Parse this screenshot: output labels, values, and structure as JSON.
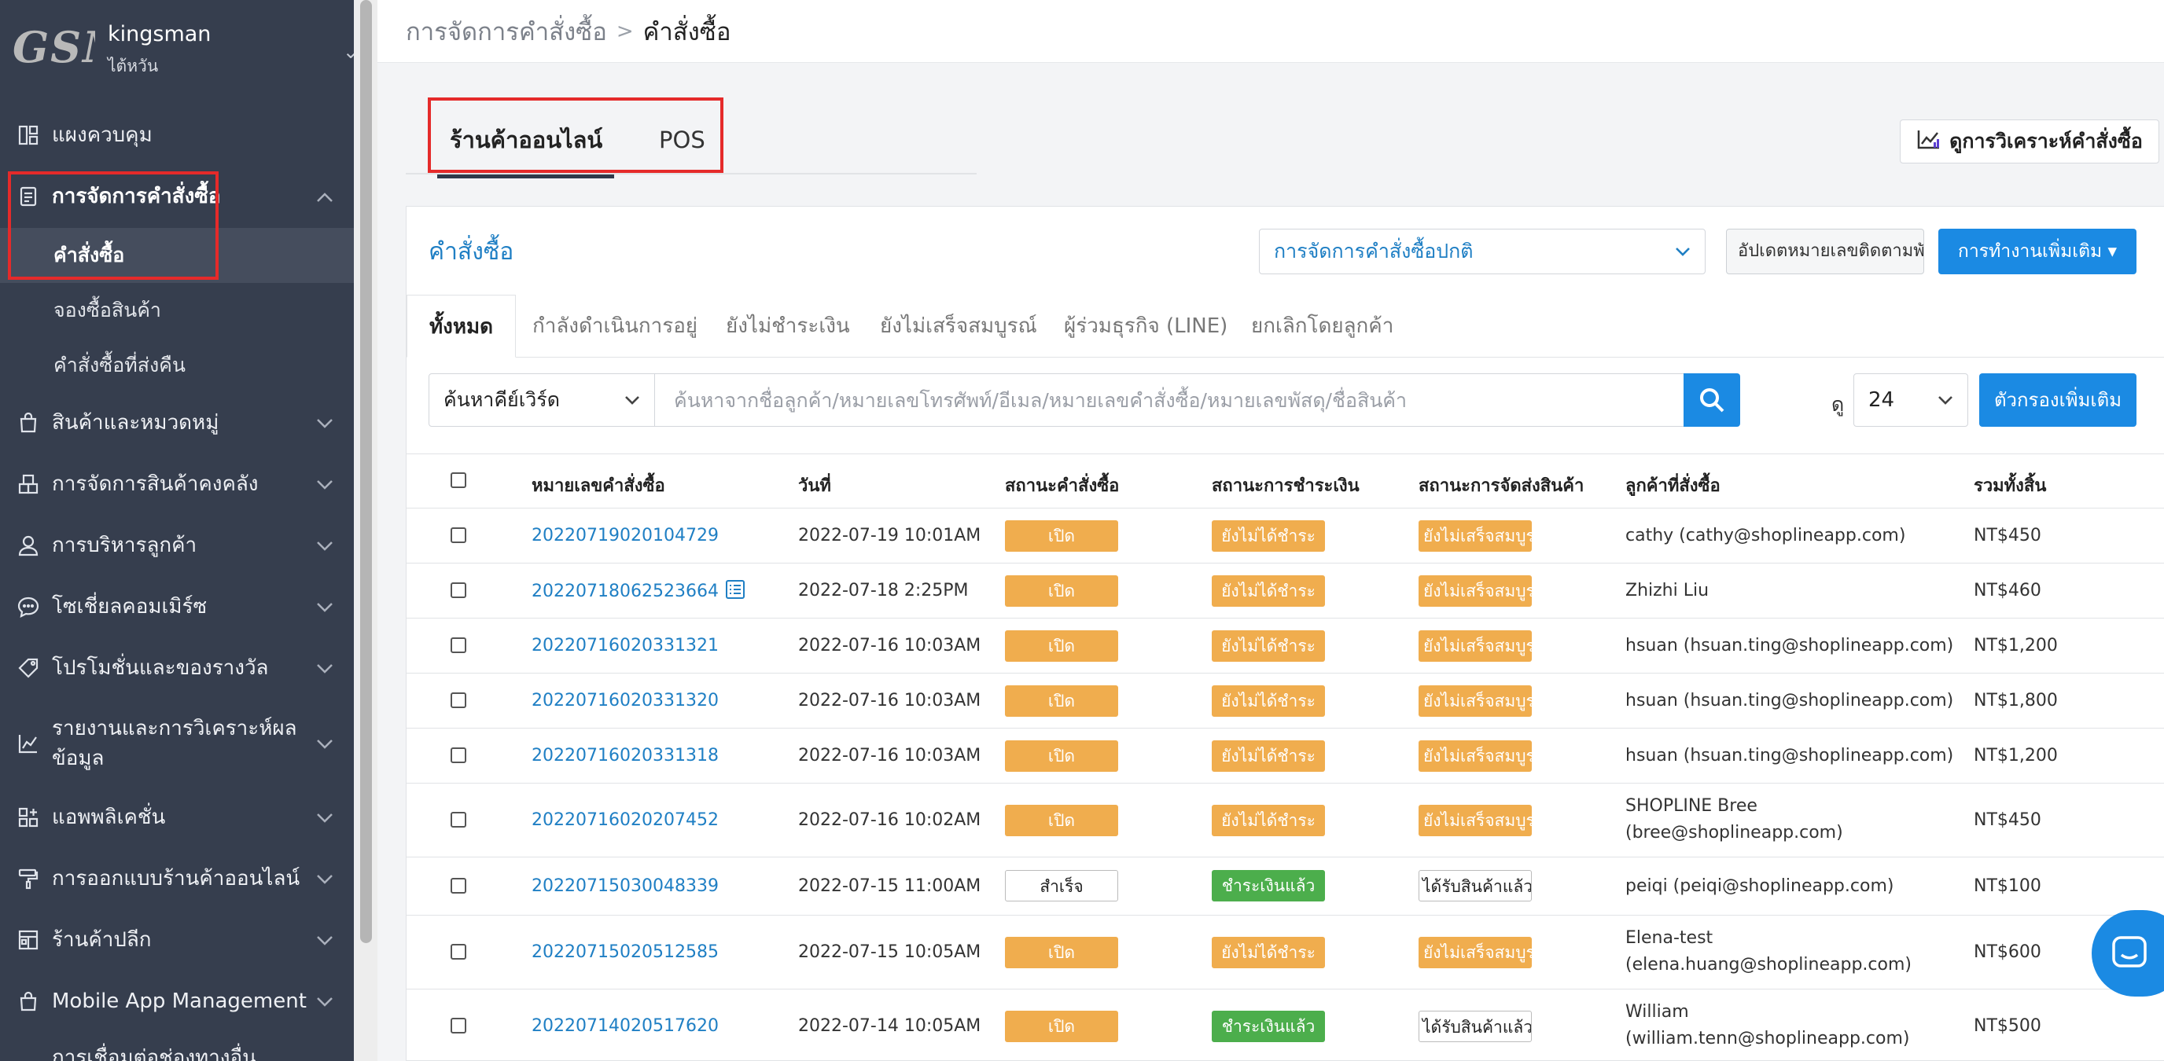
{
  "store": {
    "logo_text": "GSM",
    "name": "kingsman",
    "region": "ไต้หวัน"
  },
  "sidebar": {
    "items": [
      {
        "label": "แผงควบคุม",
        "icon": "dashboard-icon"
      },
      {
        "label": "การจัดการคำสั่งซื้อ",
        "icon": "order-list-icon",
        "expanded": true
      },
      {
        "label": "สินค้าและหมวดหมู่",
        "icon": "shopping-bag-icon"
      },
      {
        "label": "การจัดการสินค้าคงคลัง",
        "icon": "warehouse-icon"
      },
      {
        "label": "การบริหารลูกค้า",
        "icon": "user-icon"
      },
      {
        "label": "โซเชี่ยลคอมเมิร์ซ",
        "icon": "chat-icon"
      },
      {
        "label": "โปรโมชั่นและของรางวัล",
        "icon": "tag-icon"
      },
      {
        "label": "รายงานและการวิเคราะห์ผลข้อมูล",
        "icon": "chart-icon"
      },
      {
        "label": "แอพพลิเคชั่น",
        "icon": "apps-icon"
      },
      {
        "label": "การออกแบบร้านค้าออนไลน์",
        "icon": "brush-icon"
      },
      {
        "label": "ร้านค้าปลีก",
        "icon": "store-icon"
      },
      {
        "label": "Mobile App Management",
        "icon": "mobile-icon"
      },
      {
        "label": "การเชื่อมต่อช่องทางอื่น",
        "icon": "link-icon"
      }
    ],
    "order_submenu": [
      {
        "label": "คำสั่งซื้อ",
        "current": true
      },
      {
        "label": "จองซื้อสินค้า"
      },
      {
        "label": "คำสั่งซื้อที่ส่งคืน"
      }
    ]
  },
  "breadcrumb": {
    "parent": "การจัดการคำสั่งซื้อ",
    "separator": ">",
    "current": "คำสั่งซื้อ"
  },
  "channel_tabs": [
    {
      "label": "ร้านค้าออนไลน์",
      "active": true
    },
    {
      "label": "POS"
    }
  ],
  "analytics_button": "ดูการวิเคราะห์คำสั่งซื้อ",
  "panel": {
    "title": "คำสั่งซื้อ",
    "flow_select": "การจัดการคำสั่งซื้อปกติ",
    "tracking_button": "อัปเดตหมายเลขติดตามพัสดุ",
    "more_actions_button": "การทำงานเพิ่มเติม ▾"
  },
  "status_tabs": [
    {
      "label": "ทั้งหมด",
      "active": true
    },
    {
      "label": "กำลังดำเนินการอยู่"
    },
    {
      "label": "ยังไม่ชำระเงิน"
    },
    {
      "label": "ยังไม่เสร็จสมบูรณ์"
    },
    {
      "label": "ผู้ร่วมธุรกิจ (LINE)"
    },
    {
      "label": "ยกเลิกโดยลูกค้า"
    }
  ],
  "search": {
    "keyword_select": "ค้นหาคีย์เวิร์ด",
    "placeholder": "ค้นหาจากชื่อลูกค้า/หมายเลขโทรศัพท์/อีเมล/หมายเลขคำสั่งซื้อ/หมายเลขพัสดุ/ชื่อสินค้า",
    "view_label": "ดู",
    "per_page": "24",
    "filter_button": "ตัวกรองเพิ่มเติม"
  },
  "table": {
    "headers": [
      "หมายเลขคำสั่งซื้อ",
      "วันที่",
      "สถานะคำสั่งซื้อ",
      "สถานะการชำระเงิน",
      "สถานะการจัดส่งสินค้า",
      "ลูกค้าที่สั่งซื้อ",
      "รวมทั้งสิ้น"
    ],
    "rows": [
      {
        "order": "20220719020104729",
        "date": "2022-07-19 10:01AM",
        "status": "เปิด",
        "payment": "ยังไม่ได้ชำระ",
        "delivery": "ยังไม่เสร็จสมบูรณ์",
        "customer": "cathy (cathy@shoplineapp.com)",
        "customer2": "",
        "total": "NT$450"
      },
      {
        "order": "20220718062523664",
        "date": "2022-07-18 2:25PM",
        "status": "เปิด",
        "payment": "ยังไม่ได้ชำระ",
        "delivery": "ยังไม่เสร็จสมบูรณ์",
        "customer": "Zhizhi Liu",
        "customer2": "",
        "total": "NT$460",
        "note": true
      },
      {
        "order": "20220716020331321",
        "date": "2022-07-16 10:03AM",
        "status": "เปิด",
        "payment": "ยังไม่ได้ชำระ",
        "delivery": "ยังไม่เสร็จสมบูรณ์",
        "customer": "hsuan (hsuan.ting@shoplineapp.com)",
        "customer2": "",
        "total": "NT$1,200"
      },
      {
        "order": "20220716020331320",
        "date": "2022-07-16 10:03AM",
        "status": "เปิด",
        "payment": "ยังไม่ได้ชำระ",
        "delivery": "ยังไม่เสร็จสมบูรณ์",
        "customer": "hsuan (hsuan.ting@shoplineapp.com)",
        "customer2": "",
        "total": "NT$1,800"
      },
      {
        "order": "20220716020331318",
        "date": "2022-07-16 10:03AM",
        "status": "เปิด",
        "payment": "ยังไม่ได้ชำระ",
        "delivery": "ยังไม่เสร็จสมบูรณ์",
        "customer": "hsuan (hsuan.ting@shoplineapp.com)",
        "customer2": "",
        "total": "NT$1,200"
      },
      {
        "order": "20220716020207452",
        "date": "2022-07-16 10:02AM",
        "status": "เปิด",
        "payment": "ยังไม่ได้ชำระ",
        "delivery": "ยังไม่เสร็จสมบูรณ์",
        "customer": "SHOPLINE Bree",
        "customer2": "(bree@shoplineapp.com)",
        "total": "NT$450"
      },
      {
        "order": "20220715030048339",
        "date": "2022-07-15 11:00AM",
        "status": "สำเร็จ",
        "payment": "ชำระเงินแล้ว",
        "delivery": "ได้รับสินค้าแล้ว",
        "customer": "peiqi (peiqi@shoplineapp.com)",
        "customer2": "",
        "total": "NT$100"
      },
      {
        "order": "20220715020512585",
        "date": "2022-07-15 10:05AM",
        "status": "เปิด",
        "payment": "ยังไม่ได้ชำระ",
        "delivery": "ยังไม่เสร็จสมบูรณ์",
        "customer": "Elena-test",
        "customer2": "(elena.huang@shoplineapp.com)",
        "total": "NT$600"
      },
      {
        "order": "20220714020517620",
        "date": "2022-07-14 10:05AM",
        "status": "เปิด",
        "payment": "ชำระเงินแล้ว",
        "delivery": "ได้รับสินค้าแล้ว",
        "customer": "William",
        "customer2": "(william.tenn@shoplineapp.com)",
        "total": "NT$500"
      }
    ]
  }
}
